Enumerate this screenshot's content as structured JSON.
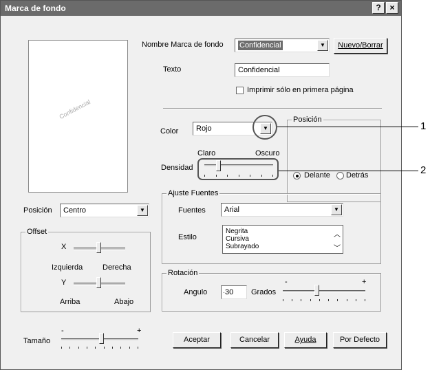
{
  "window": {
    "title": "Marca de fondo",
    "help_label": "?",
    "close_label": "×"
  },
  "preview": {
    "watermark_text": "Confidencial"
  },
  "watermark": {
    "name_label": "Nombre Marca de fondo",
    "name_value": "Confidencial",
    "new_delete_button": "Nuevo/Borrar",
    "text_label": "Texto",
    "text_value": "Confidencial",
    "first_page_only_label": "Imprimir sólo en primera página",
    "first_page_only_checked": false
  },
  "color": {
    "label": "Color",
    "value": "Rojo"
  },
  "density": {
    "label": "Densidad",
    "light_label": "Claro",
    "dark_label": "Oscuro",
    "level": 0.2
  },
  "layer_position": {
    "legend": "Posición",
    "front_label": "Delante",
    "back_label": "Detrás",
    "selected": "front"
  },
  "position": {
    "label": "Posición",
    "value": "Centro"
  },
  "offset": {
    "legend": "Offset",
    "x_label": "X",
    "left_label": "Izquierda",
    "right_label": "Derecha",
    "y_label": "Y",
    "up_label": "Arriba",
    "down_label": "Abajo"
  },
  "size": {
    "label": "Tamaño",
    "minus": "-",
    "plus": "+"
  },
  "font_settings": {
    "legend": "Ajuste Fuentes",
    "font_label": "Fuentes",
    "font_value": "Arial",
    "style_label": "Estilo",
    "styles": [
      "Negrita",
      "Cursiva",
      "Subrayado"
    ]
  },
  "rotation": {
    "legend": "Rotación",
    "angle_label": "Angulo",
    "angle_value": "30",
    "degrees_label": "Grados",
    "minus": "-",
    "plus": "+"
  },
  "buttons": {
    "accept": "Aceptar",
    "cancel": "Cancelar",
    "help": "Ayuda",
    "default": "Por Defecto"
  },
  "callouts": {
    "one": "1",
    "two": "2"
  }
}
